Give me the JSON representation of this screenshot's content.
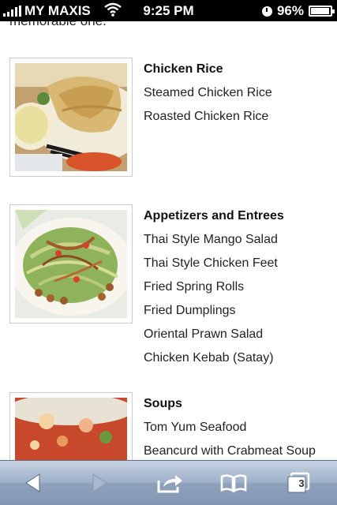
{
  "status_bar": {
    "carrier": "MY MAXIS",
    "time": "9:25 PM",
    "battery": "96%",
    "battery_level": 0.96,
    "wifi_icon": "wifi-icon",
    "alarm_icon": "clock-icon"
  },
  "page": {
    "intro_fragment": "memorable one."
  },
  "sections": [
    {
      "title": "Chicken Rice",
      "items": [
        "Steamed Chicken Rice",
        "Roasted Chicken Rice"
      ]
    },
    {
      "title": "Appetizers and Entrees",
      "items": [
        "Thai Style Mango Salad",
        "Thai Style Chicken Feet",
        "Fried Spring Rolls",
        "Fried Dumplings",
        "Oriental Prawn Salad",
        "Chicken Kebab (Satay)"
      ]
    },
    {
      "title": "Soups",
      "items": [
        "Tom Yum Seafood",
        "Beancurd with Crabmeat Soup"
      ]
    }
  ],
  "toolbar": {
    "back_icon": "back-arrow-icon",
    "forward_icon": "forward-arrow-icon",
    "share_icon": "share-icon",
    "bookmarks_icon": "bookmarks-icon",
    "tabs_icon": "tabs-icon",
    "tabs_count": "3"
  }
}
